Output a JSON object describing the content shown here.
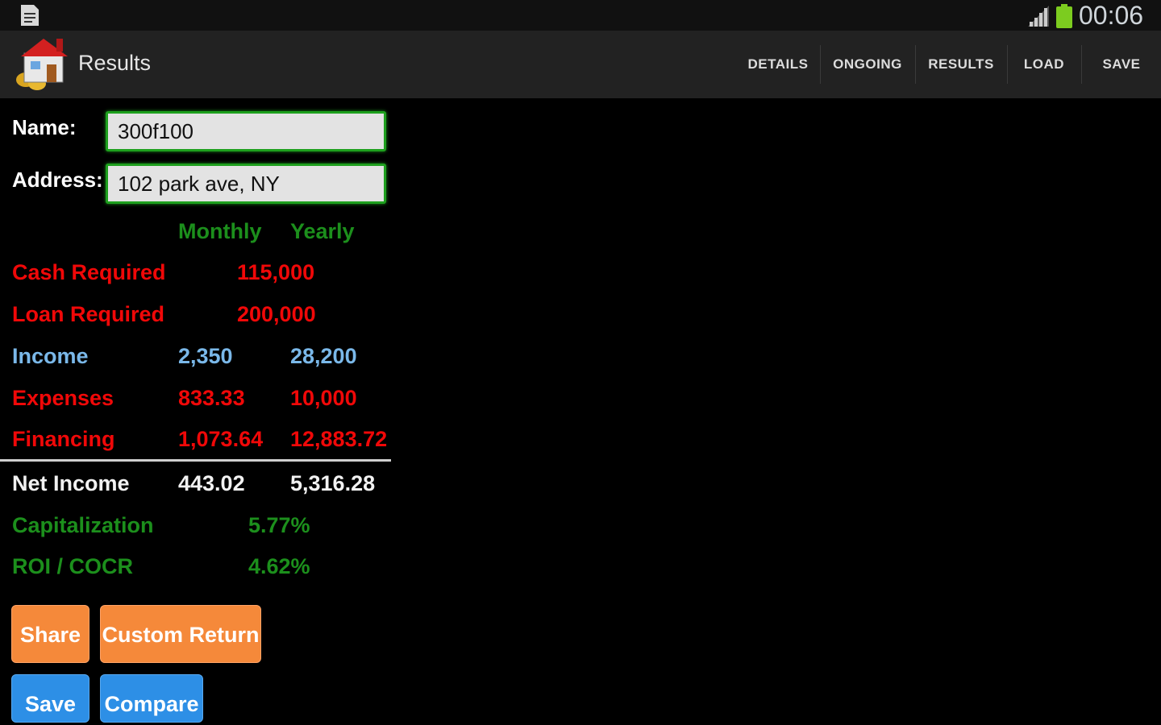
{
  "status_bar": {
    "time": "00:06",
    "icons": [
      "notification-icon",
      "signal-icon",
      "battery-icon"
    ],
    "battery_color": "#7ccc1f"
  },
  "action_bar": {
    "title": "Results",
    "actions": [
      "DETAILS",
      "ONGOING",
      "RESULTS",
      "LOAD",
      "SAVE"
    ]
  },
  "form": {
    "name_label": "Name:",
    "name_value": "300f100",
    "address_label": "Address:",
    "address_value": "102 park ave, NY"
  },
  "columns": {
    "monthly": "Monthly",
    "yearly": "Yearly"
  },
  "results": {
    "cash_required": {
      "label": "Cash Required",
      "value": "115,000"
    },
    "loan_required": {
      "label": "Loan Required",
      "value": "200,000"
    },
    "income": {
      "label": "Income",
      "monthly": "2,350",
      "yearly": "28,200"
    },
    "expenses": {
      "label": "Expenses",
      "monthly": "833.33",
      "yearly": "10,000"
    },
    "financing": {
      "label": "Financing",
      "monthly": "1,073.64",
      "yearly": "12,883.72"
    },
    "net_income": {
      "label": "Net Income",
      "monthly": "443.02",
      "yearly": "5,316.28"
    },
    "capitalization": {
      "label": "Capitalization",
      "value": "5.77%"
    },
    "roi": {
      "label": "ROI / COCR",
      "value": "4.62%"
    }
  },
  "buttons": {
    "share": "Share",
    "custom_return": "Custom Return",
    "save": "Save",
    "compare": "Compare"
  },
  "colors": {
    "accent_green": "#1c8f1c",
    "negative_red": "#f00808",
    "income_blue": "#7ab8e9",
    "button_orange": "#f5893a",
    "button_blue": "#2d8fe6"
  }
}
